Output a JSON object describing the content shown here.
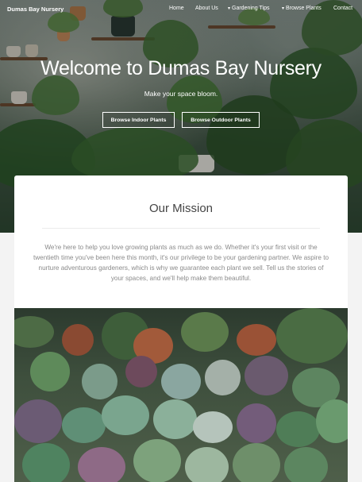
{
  "nav": {
    "brand": "Dumas Bay Nursery",
    "items": [
      {
        "label": "Home",
        "dropdown": false
      },
      {
        "label": "About Us",
        "dropdown": false
      },
      {
        "label": "Gardening Tips",
        "dropdown": true
      },
      {
        "label": "Browse Plants",
        "dropdown": true
      },
      {
        "label": "Contact",
        "dropdown": false
      }
    ]
  },
  "hero": {
    "title": "Welcome to Dumas Bay Nursery",
    "subtitle": "Make your space bloom.",
    "buttons": [
      "Browse Indoor Plants",
      "Browse Outdoor Plants"
    ]
  },
  "mission": {
    "title": "Our Mission",
    "text": "We're here to help you love growing plants as much as we do. Whether it's your first visit or the twentieth time you've been here this month, it's our privilege to be your gardening partner. We aspire to nurture adventurous gardeners, which is why we guarantee each plant we sell. Tell us the stories of your spaces, and we'll help make them beautiful."
  },
  "colors": {
    "card": "#ffffff",
    "page": "#f3f3f3",
    "text_muted": "#8a8a8a"
  }
}
